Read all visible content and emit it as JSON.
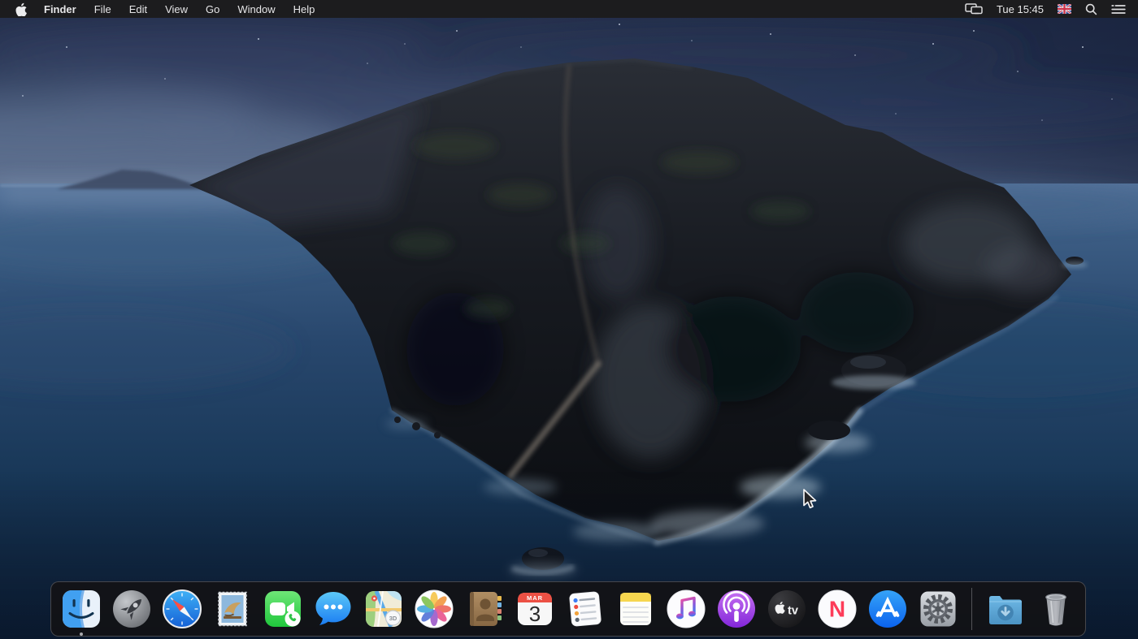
{
  "menu_bar": {
    "apple_menu": "apple-logo",
    "items": [
      {
        "label": "Finder",
        "bold": true
      },
      {
        "label": "File"
      },
      {
        "label": "Edit"
      },
      {
        "label": "View"
      },
      {
        "label": "Go"
      },
      {
        "label": "Window"
      },
      {
        "label": "Help"
      }
    ],
    "status": {
      "display_icon": "display-mirroring",
      "clock": "Tue 15:45",
      "input_flag": "uk-union-jack",
      "search_icon": "spotlight-search",
      "list_icon": "notification-center-list"
    }
  },
  "desktop": {
    "wallpaper": "macOS Catalina island at night",
    "cursor": "arrow-pointer"
  },
  "dock": {
    "apps": [
      {
        "name": "finder",
        "running": true
      },
      {
        "name": "launchpad"
      },
      {
        "name": "safari"
      },
      {
        "name": "mail"
      },
      {
        "name": "facetime"
      },
      {
        "name": "messages"
      },
      {
        "name": "maps",
        "badge": "3D"
      },
      {
        "name": "photos"
      },
      {
        "name": "contacts"
      },
      {
        "name": "calendar",
        "month": "MAR",
        "day": "3"
      },
      {
        "name": "reminders"
      },
      {
        "name": "notes"
      },
      {
        "name": "music"
      },
      {
        "name": "podcasts"
      },
      {
        "name": "apple-tv",
        "label": "tv"
      },
      {
        "name": "news",
        "letter": "N"
      },
      {
        "name": "app-store"
      },
      {
        "name": "system-preferences"
      }
    ],
    "others": [
      {
        "name": "downloads-folder"
      },
      {
        "name": "trash"
      }
    ]
  },
  "colors": {
    "menu_bar_bg": "#1c1c1e",
    "dock_bg": "rgba(19,19,21,0.9)",
    "sky_top": "#222d49",
    "sky_horizon": "#5a6b8c",
    "ocean_deep": "#0e2138",
    "island_dark": "#14171c",
    "accent_calendar_red": "#ec5044"
  }
}
